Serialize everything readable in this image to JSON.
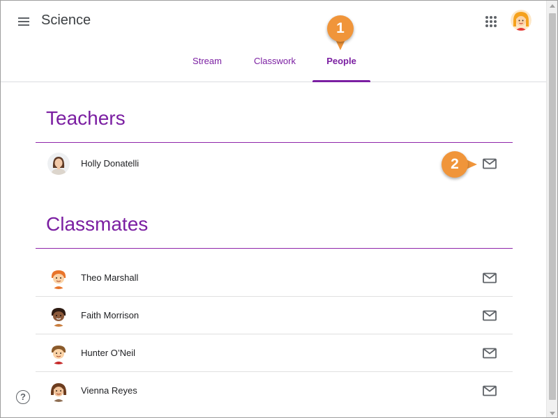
{
  "header": {
    "title": "Science",
    "menu_icon": "hamburger-menu-icon",
    "apps_icon": "apps-grid-icon"
  },
  "tabs": [
    {
      "label": "Stream",
      "active": false
    },
    {
      "label": "Classwork",
      "active": false
    },
    {
      "label": "People",
      "active": true
    }
  ],
  "teachers": {
    "heading": "Teachers",
    "people": [
      {
        "name": "Holly Donatelli",
        "action_icon": "email-icon"
      }
    ]
  },
  "classmates": {
    "heading": "Classmates",
    "people": [
      {
        "name": "Theo Marshall",
        "action_icon": "email-icon"
      },
      {
        "name": "Faith Morrison",
        "action_icon": "email-icon"
      },
      {
        "name": "Hunter O’Neil",
        "action_icon": "email-icon"
      },
      {
        "name": "Vienna Reyes",
        "action_icon": "email-icon"
      }
    ]
  },
  "callouts": {
    "one": "1",
    "two": "2"
  },
  "help": {
    "label": "?"
  },
  "colors": {
    "accent": "#7b1fa2",
    "callout": "#f0953a",
    "divider": "#e0e0e0"
  }
}
